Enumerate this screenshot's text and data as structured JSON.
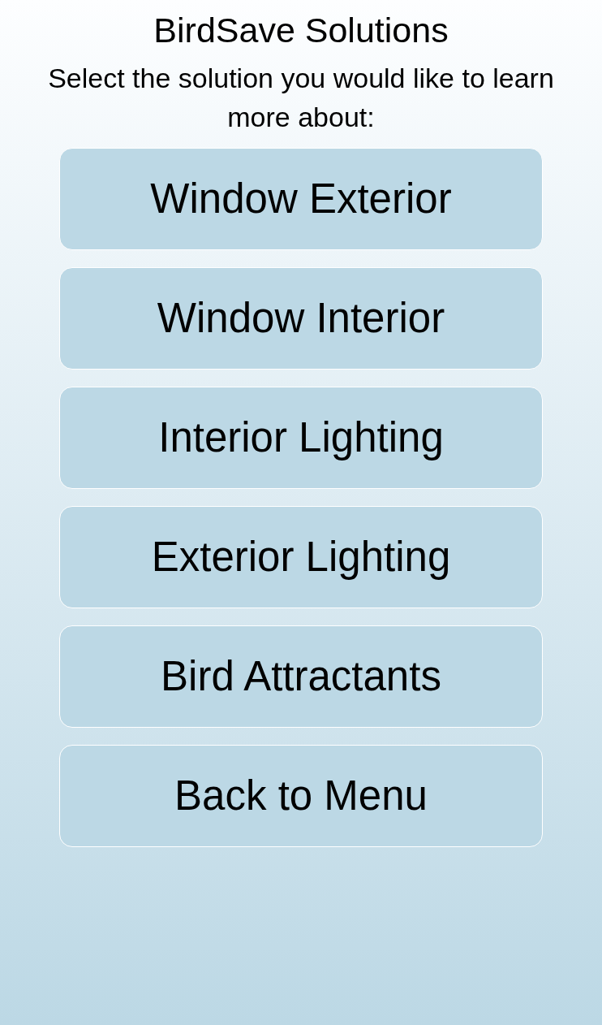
{
  "title": "BirdSave Solutions",
  "prompt": "Select the solution you would like to learn more about:",
  "buttons": [
    "Window Exterior",
    "Window Interior",
    "Interior Lighting",
    "Exterior Lighting",
    "Bird Attractants",
    "Back to Menu"
  ]
}
